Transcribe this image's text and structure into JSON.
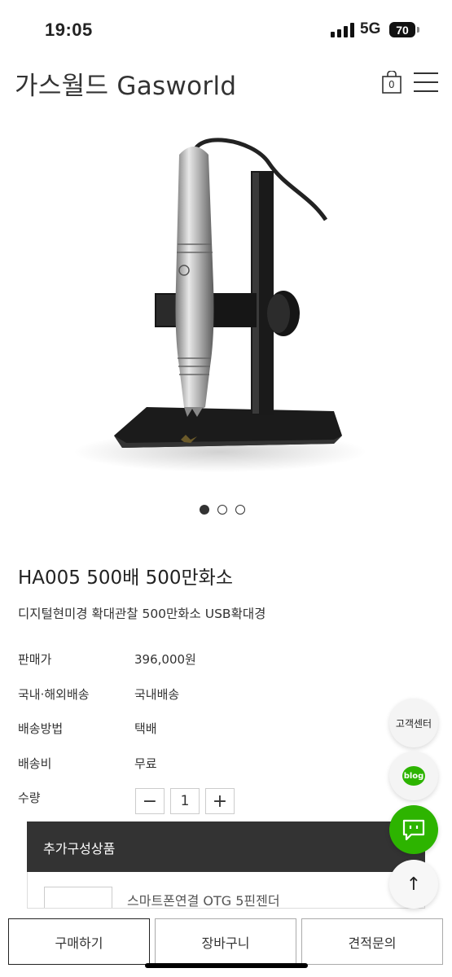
{
  "status_bar": {
    "time": "19:05",
    "network": "5G",
    "battery": "70"
  },
  "header": {
    "brand": "가스월드 Gasworld",
    "cart_count": "0"
  },
  "gallery": {
    "slide_count": 3,
    "active_index": 0
  },
  "product": {
    "title": "HA005 500배 500만화소",
    "subtitle": "디지털현미경 확대관찰 500만화소 USB확대경",
    "info": [
      {
        "label": "판매가",
        "value": "396,000원"
      },
      {
        "label": "국내·해외배송",
        "value": "국내배송"
      },
      {
        "label": "배송방법",
        "value": "택배"
      },
      {
        "label": "배송비",
        "value": "무료"
      }
    ],
    "quantity": {
      "label": "수량",
      "minus": "−",
      "value": "1",
      "plus": "+"
    }
  },
  "options": {
    "title": "추가구성상품",
    "item_name": "스마트폰연결 OTG 5핀젠더"
  },
  "floating": {
    "customer_center": "고객센터",
    "blog": "blog",
    "top": "↑"
  },
  "bottom": {
    "buy": "구매하기",
    "cart": "장바구니",
    "quote": "견적문의"
  },
  "colors": {
    "dark_bar": "#333333",
    "talk_green": "#2db400"
  }
}
